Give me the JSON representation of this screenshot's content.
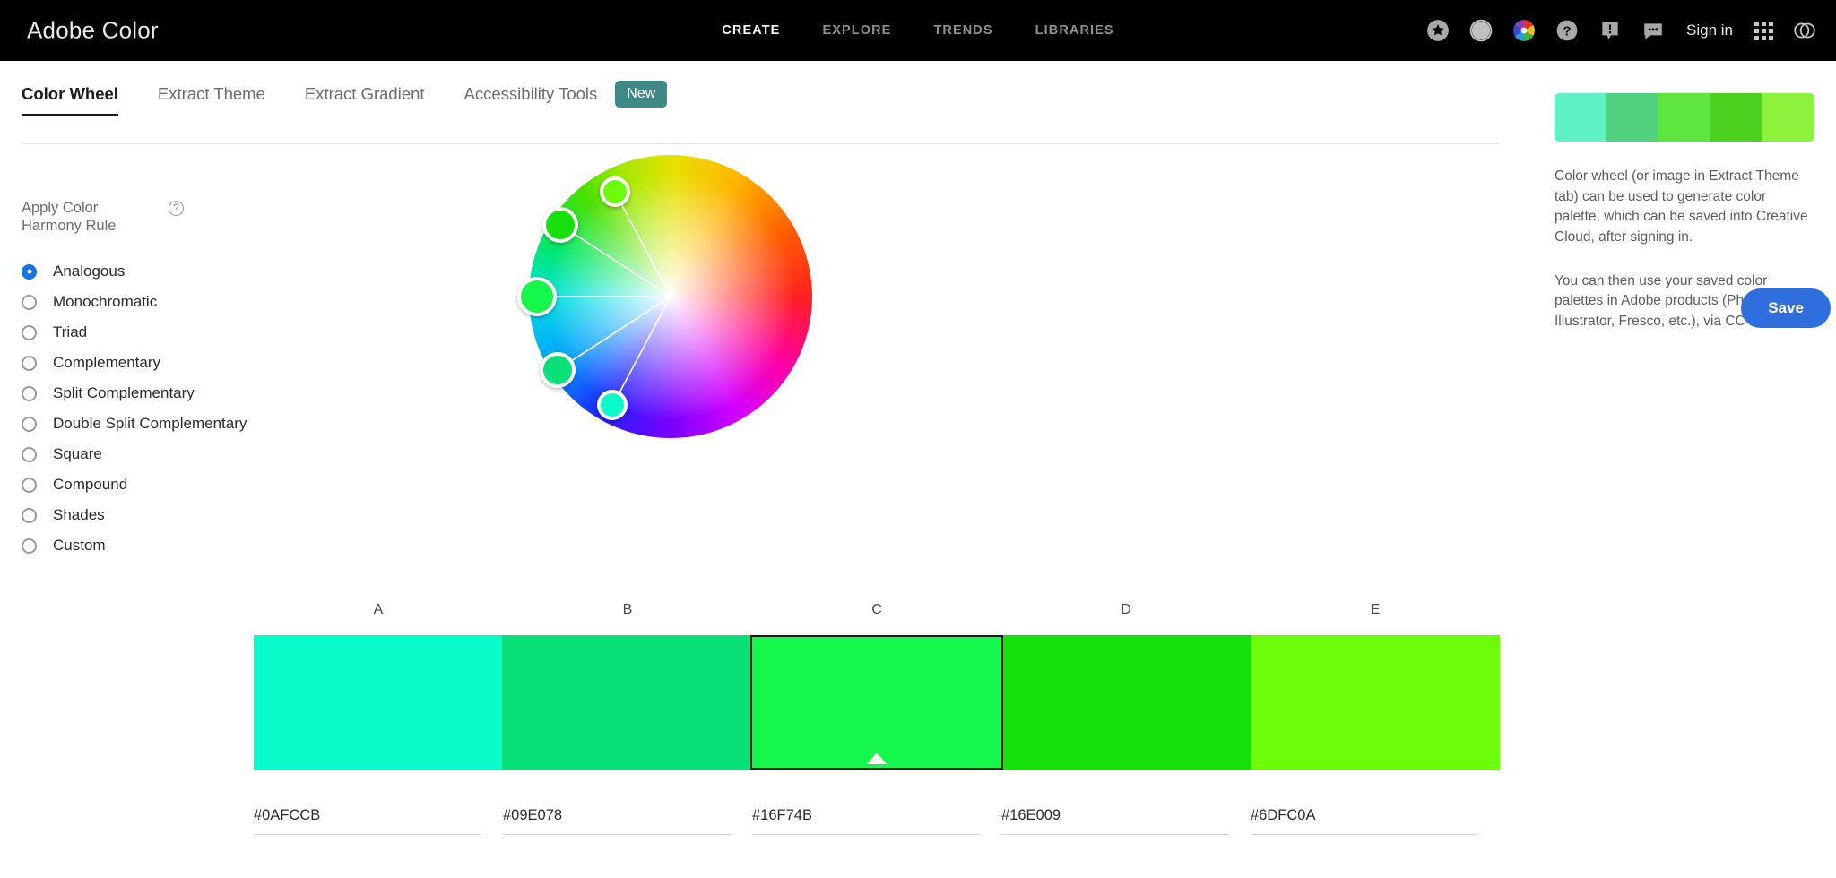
{
  "header": {
    "brand": "Adobe Color",
    "nav": [
      {
        "label": "CREATE",
        "active": true
      },
      {
        "label": "EXPLORE",
        "active": false
      },
      {
        "label": "TRENDS",
        "active": false
      },
      {
        "label": "LIBRARIES",
        "active": false
      }
    ],
    "icons": [
      "star-badge-icon",
      "contrast-theme-icon",
      "color-wheel-icon",
      "help-icon",
      "announcement-icon",
      "chat-icon"
    ],
    "sign_in": "Sign in",
    "app_grid": "app-grid-icon",
    "creative_cloud": "creative-cloud-icon"
  },
  "tabs": [
    {
      "label": "Color Wheel",
      "active": true
    },
    {
      "label": "Extract Theme",
      "active": false
    },
    {
      "label": "Extract Gradient",
      "active": false
    },
    {
      "label": "Accessibility Tools",
      "active": false
    }
  ],
  "tab_badge": "New",
  "harmony": {
    "title": "Apply Color Harmony Rule",
    "help_icon": "question-mark-icon",
    "selected": "Analogous",
    "options": [
      "Analogous",
      "Monochromatic",
      "Triad",
      "Complementary",
      "Split Complementary",
      "Double Split Complementary",
      "Square",
      "Compound",
      "Shades",
      "Custom"
    ]
  },
  "palette": {
    "active_index": 2,
    "swatches": [
      {
        "letter": "A",
        "hex": "#0AFCCB"
      },
      {
        "letter": "B",
        "hex": "#09E078"
      },
      {
        "letter": "C",
        "hex": "#16F74B"
      },
      {
        "letter": "D",
        "hex": "#16E009"
      },
      {
        "letter": "E",
        "hex": "#6DFC0A"
      }
    ]
  },
  "wheel": {
    "handles": [
      {
        "hex": "#6DFC0A",
        "angle": 118,
        "radius": 0.84,
        "size": 34
      },
      {
        "hex": "#16E009",
        "angle": 147,
        "radius": 0.93,
        "size": 40
      },
      {
        "hex": "#16F74B",
        "angle": 180,
        "radius": 0.94,
        "size": 44
      },
      {
        "hex": "#09E078",
        "angle": 213,
        "radius": 0.95,
        "size": 40
      },
      {
        "hex": "#0AFCCB",
        "angle": 242,
        "radius": 0.87,
        "size": 34
      }
    ]
  },
  "sidebar": {
    "strip": [
      "#5FF2C4",
      "#52D17E",
      "#5EE63F",
      "#4CD21E",
      "#8DF23C"
    ],
    "paragraphs": [
      "Color wheel (or image in Extract Theme tab) can be used to generate color palette, which can be saved into Creative Cloud, after signing in.",
      "You can then use your saved color palettes in Adobe products (Photoshop, Illustrator, Fresco, etc.), via CC Libraries."
    ],
    "save_label": "Save"
  },
  "colors": {
    "accent_blue": "#1473E6",
    "save_blue": "#2F6FDD",
    "badge_teal": "#3F8A86",
    "topbar_bg": "#000000"
  }
}
